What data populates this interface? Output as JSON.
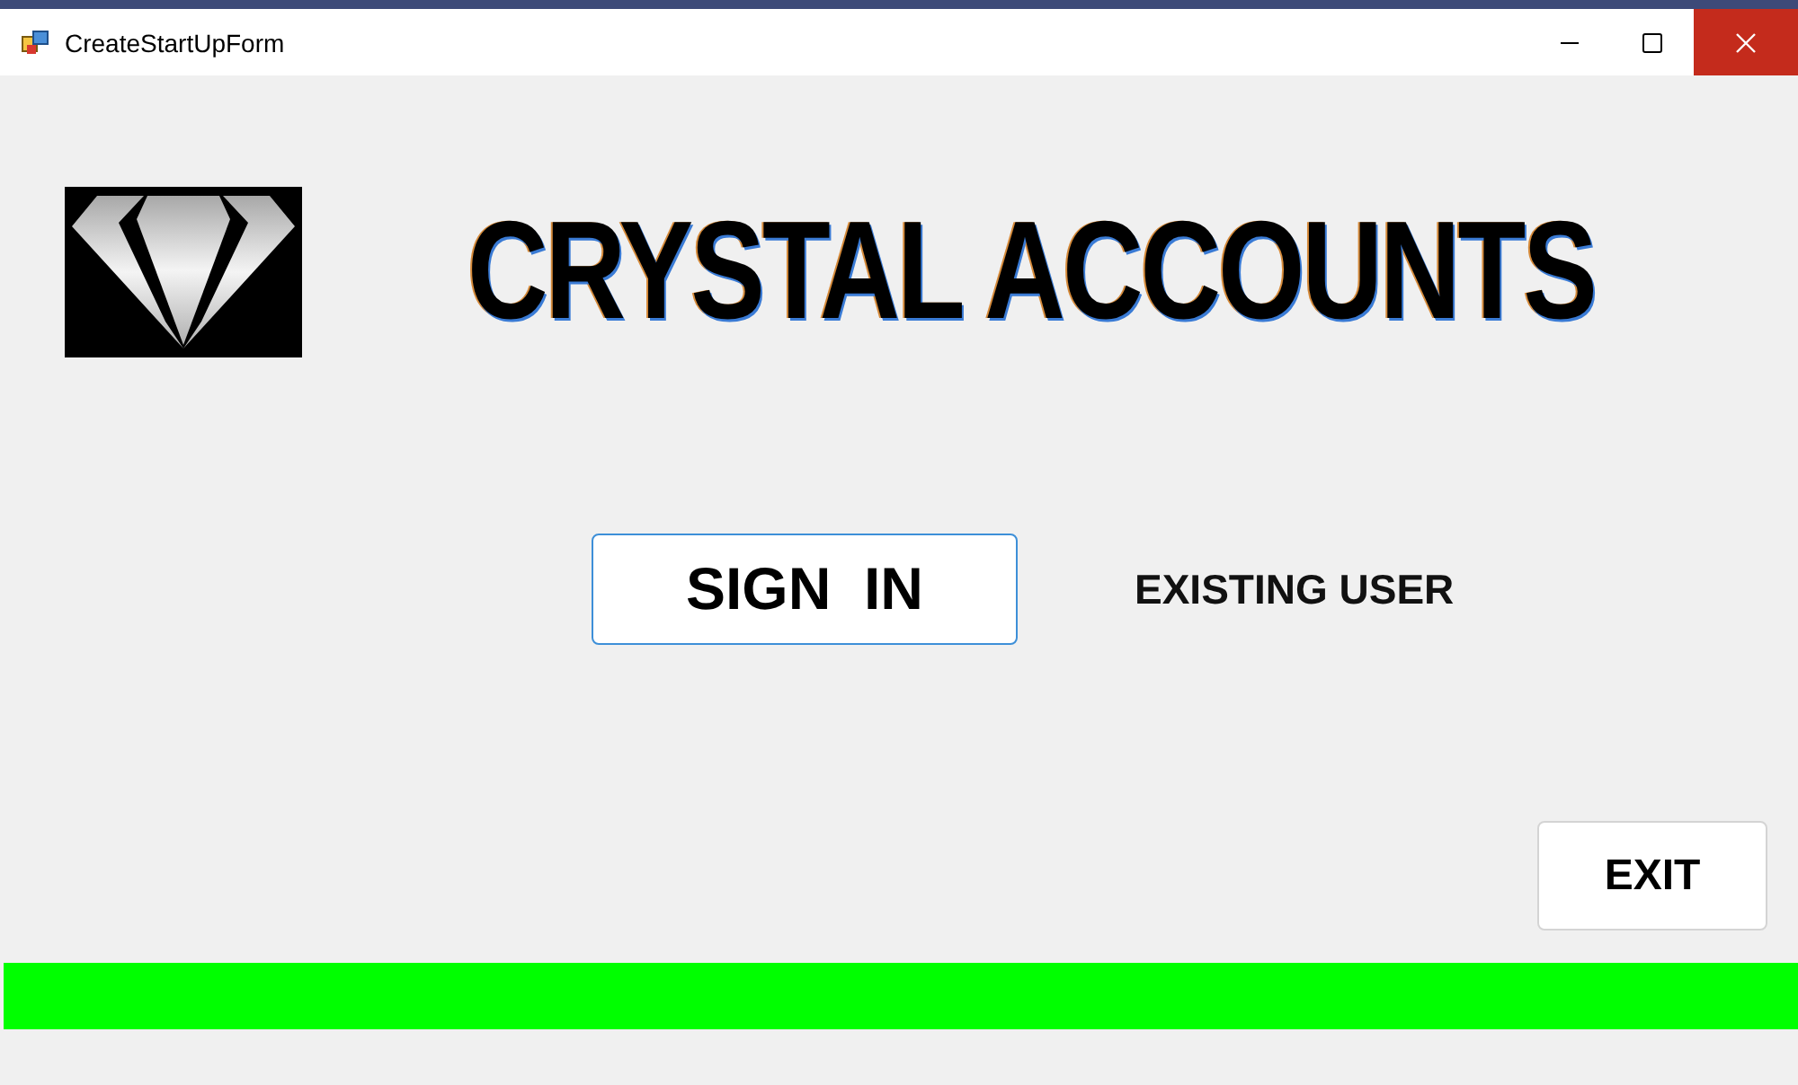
{
  "window": {
    "title": "CreateStartUpForm"
  },
  "header": {
    "title": "CRYSTAL ACCOUNTS"
  },
  "sign_in": {
    "button": "SIGN  IN",
    "label": "EXISTING USER"
  },
  "exit_button": "EXIT",
  "progress": {
    "level": 1
  }
}
